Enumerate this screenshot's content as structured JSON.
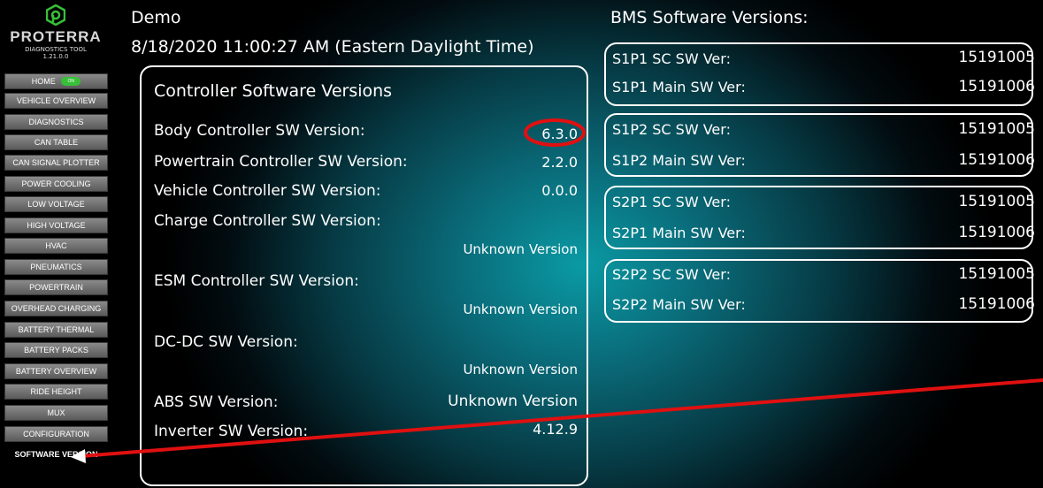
{
  "sidebar": {
    "brand": "PROTERRA",
    "tool_name": "DIAGNOSTICS TOOL",
    "tool_version": "1.21.0.0",
    "home_label": "HOME",
    "items": [
      "VEHICLE OVERVIEW",
      "DIAGNOSTICS",
      "CAN TABLE",
      "CAN SIGNAL PLOTTER",
      "POWER COOLING",
      "LOW VOLTAGE",
      "HIGH VOLTAGE",
      "HVAC",
      "PNEUMATICS",
      "POWERTRAIN",
      "OVERHEAD CHARGING",
      "BATTERY THERMAL",
      "BATTERY PACKS",
      "BATTERY OVERVIEW",
      "RIDE HEIGHT",
      "MUX",
      "CONFIGURATION",
      "SOFTWARE VERSION"
    ],
    "active_item": "SOFTWARE VERSION"
  },
  "header": {
    "vehicle": "Demo",
    "datetime": "8/18/2020 11:00:27 AM (Eastern Daylight Time)",
    "bms_title": "BMS Software Versions:"
  },
  "controller": {
    "title": "Controller Software Versions",
    "body_label": "Body Controller SW Version:",
    "body_value": "6.3.0",
    "powertrain_label": "Powertrain Controller SW Version:",
    "powertrain_value": "2.2.0",
    "vehicle_label": "Vehicle Controller SW Version:",
    "vehicle_value": "0.0.0",
    "charge_label": "Charge Controller SW Version:",
    "charge_value": "Unknown Version",
    "esm_label": "ESM Controller SW Version:",
    "esm_value": "Unknown Version",
    "dcdc_label": "DC-DC SW Version:",
    "dcdc_value": "Unknown Version",
    "abs_label": "ABS SW Version:",
    "abs_value": "Unknown Version",
    "inverter_label": "Inverter SW Version:",
    "inverter_value": "4.12.9"
  },
  "bms": {
    "s1p1_sc_label": "S1P1 SC SW Ver:",
    "s1p1_sc_value": "15191005",
    "s1p1_main_label": "S1P1 Main SW Ver:",
    "s1p1_main_value": "15191006",
    "s1p2_sc_label": "S1P2 SC SW Ver:",
    "s1p2_sc_value": "15191005",
    "s1p2_main_label": "S1P2 Main SW Ver:",
    "s1p2_main_value": "15191006",
    "s2p1_sc_label": "S2P1 SC SW Ver:",
    "s2p1_sc_value": "15191005",
    "s2p1_main_label": "S2P1 Main SW Ver:",
    "s2p1_main_value": "15191006",
    "s2p2_sc_label": "S2P2 SC SW Ver:",
    "s2p2_sc_value": "15191005",
    "s2p2_main_label": "S2P2 Main SW Ver:",
    "s2p2_main_value": "15191006"
  },
  "colors": {
    "logo_green": "#38c038",
    "annotation_red": "#e01010",
    "teal_glow": "#0a9aa4"
  }
}
